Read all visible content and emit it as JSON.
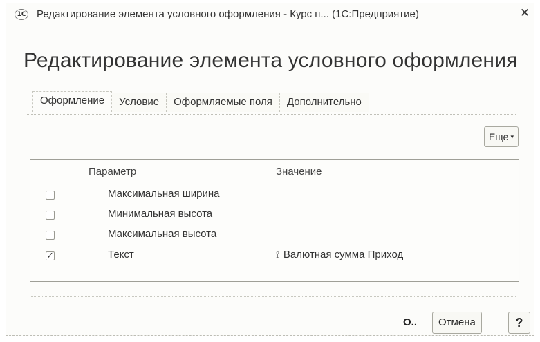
{
  "window": {
    "logo_text": "1С",
    "title": "Редактирование элемента условного оформления - Курс п... (1С:Предприятие)",
    "close_glyph": "✕"
  },
  "form": {
    "heading": "Редактирование элемента условного оформления"
  },
  "tabs": [
    {
      "label": "Оформление",
      "active": true
    },
    {
      "label": "Условие",
      "active": false
    },
    {
      "label": "Оформляемые поля",
      "active": false
    },
    {
      "label": "Дополнительно",
      "active": false
    }
  ],
  "toolbar": {
    "more_label": "Еще",
    "more_caret": "▾"
  },
  "table": {
    "columns": {
      "parameter": "Параметр",
      "value": "Значение"
    },
    "rows": [
      {
        "name": "Максимальная ширина",
        "checked": false,
        "value": "",
        "icon": ""
      },
      {
        "name": "Минимальная высота",
        "checked": false,
        "value": "",
        "icon": ""
      },
      {
        "name": "Максимальная высота",
        "checked": false,
        "value": "",
        "icon": ""
      },
      {
        "name": "Текст",
        "checked": true,
        "value": "Валютная сумма Приход",
        "icon": "field-icon"
      }
    ],
    "check_glyph": "✓",
    "value_icon_glyph": "⟟"
  },
  "footer": {
    "ok_label": "О..",
    "cancel_label": "Отмена",
    "help_label": "?"
  }
}
